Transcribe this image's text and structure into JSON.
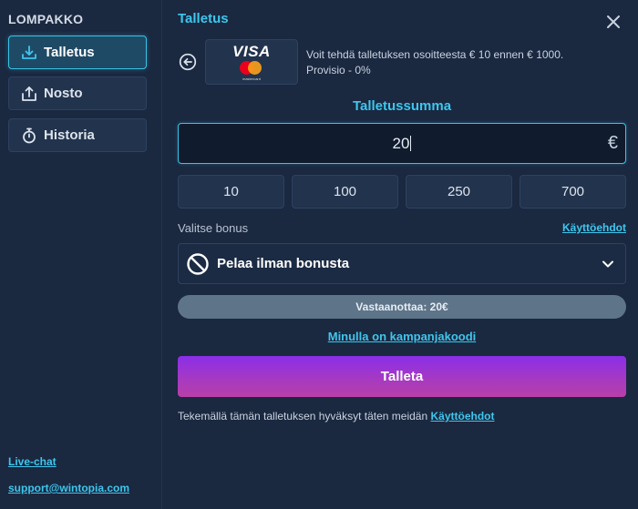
{
  "sidebar": {
    "title": "LOMPAKKO",
    "items": [
      {
        "label": "Talletus",
        "icon": "download-icon",
        "active": true
      },
      {
        "label": "Nosto",
        "icon": "upload-icon",
        "active": false
      },
      {
        "label": "Historia",
        "icon": "stopwatch-icon",
        "active": false
      }
    ],
    "live_chat": "Live-chat",
    "support_email": "support@wintopia.com"
  },
  "main": {
    "title": "Talletus",
    "payment_method": {
      "brand": "VISA",
      "secondary_brand": "mastercard",
      "info_line1": "Voit tehdä talletuksen osoitteesta € 10 ennen € 1000.",
      "info_line2": "Provisio - 0%"
    },
    "amount": {
      "label": "Talletussumma",
      "value": "20",
      "currency": "€"
    },
    "presets": [
      "10",
      "100",
      "250",
      "700"
    ],
    "bonus": {
      "label": "Valitse bonus",
      "terms_link": "Käyttöehdot",
      "selected": "Pelaa ilman bonusta"
    },
    "receive_text": "Vastaanottaa: 20€",
    "promo_link": "Minulla on kampanjakoodi",
    "deposit_button": "Talleta",
    "footer": {
      "text": "Tekemällä tämän talletuksen hyväksyt täten meidän",
      "link": "Käyttöehdot"
    }
  },
  "colors": {
    "background": "#1a2840",
    "accent": "#3fc6ec",
    "button_gradient_top": "#8a2ee8",
    "button_gradient_bottom": "#b83fa8"
  }
}
